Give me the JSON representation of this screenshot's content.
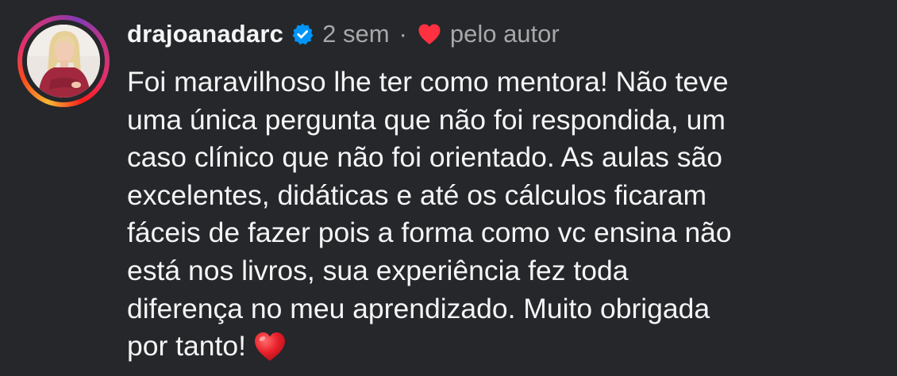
{
  "comment": {
    "username": "drajoanadarc",
    "verified_icon": "verified-badge-icon",
    "time_ago": "2 sem",
    "separator": "·",
    "liked_icon": "heart-icon",
    "liked_label": "pelo autor",
    "text": "Foi maravilhoso lhe ter como mentora! Não teve\numa única pergunta que não foi respondida, um\ncaso clínico que não foi orientado. As aulas são\nexcelentes, didáticas e até os cálculos ficaram\nfáceis de fazer pois a forma como vc ensina não\nestá nos livros, sua experiência fez toda\ndiferença no meu aprendizado. Muito obrigada\npor tanto!",
    "trailing_emoji": "red-heart-emoji"
  },
  "colors": {
    "background": "#25272b",
    "text": "#f5f5f5",
    "muted": "#a8a8a8",
    "verified": "#0095f6",
    "heart": "#ff3040"
  }
}
